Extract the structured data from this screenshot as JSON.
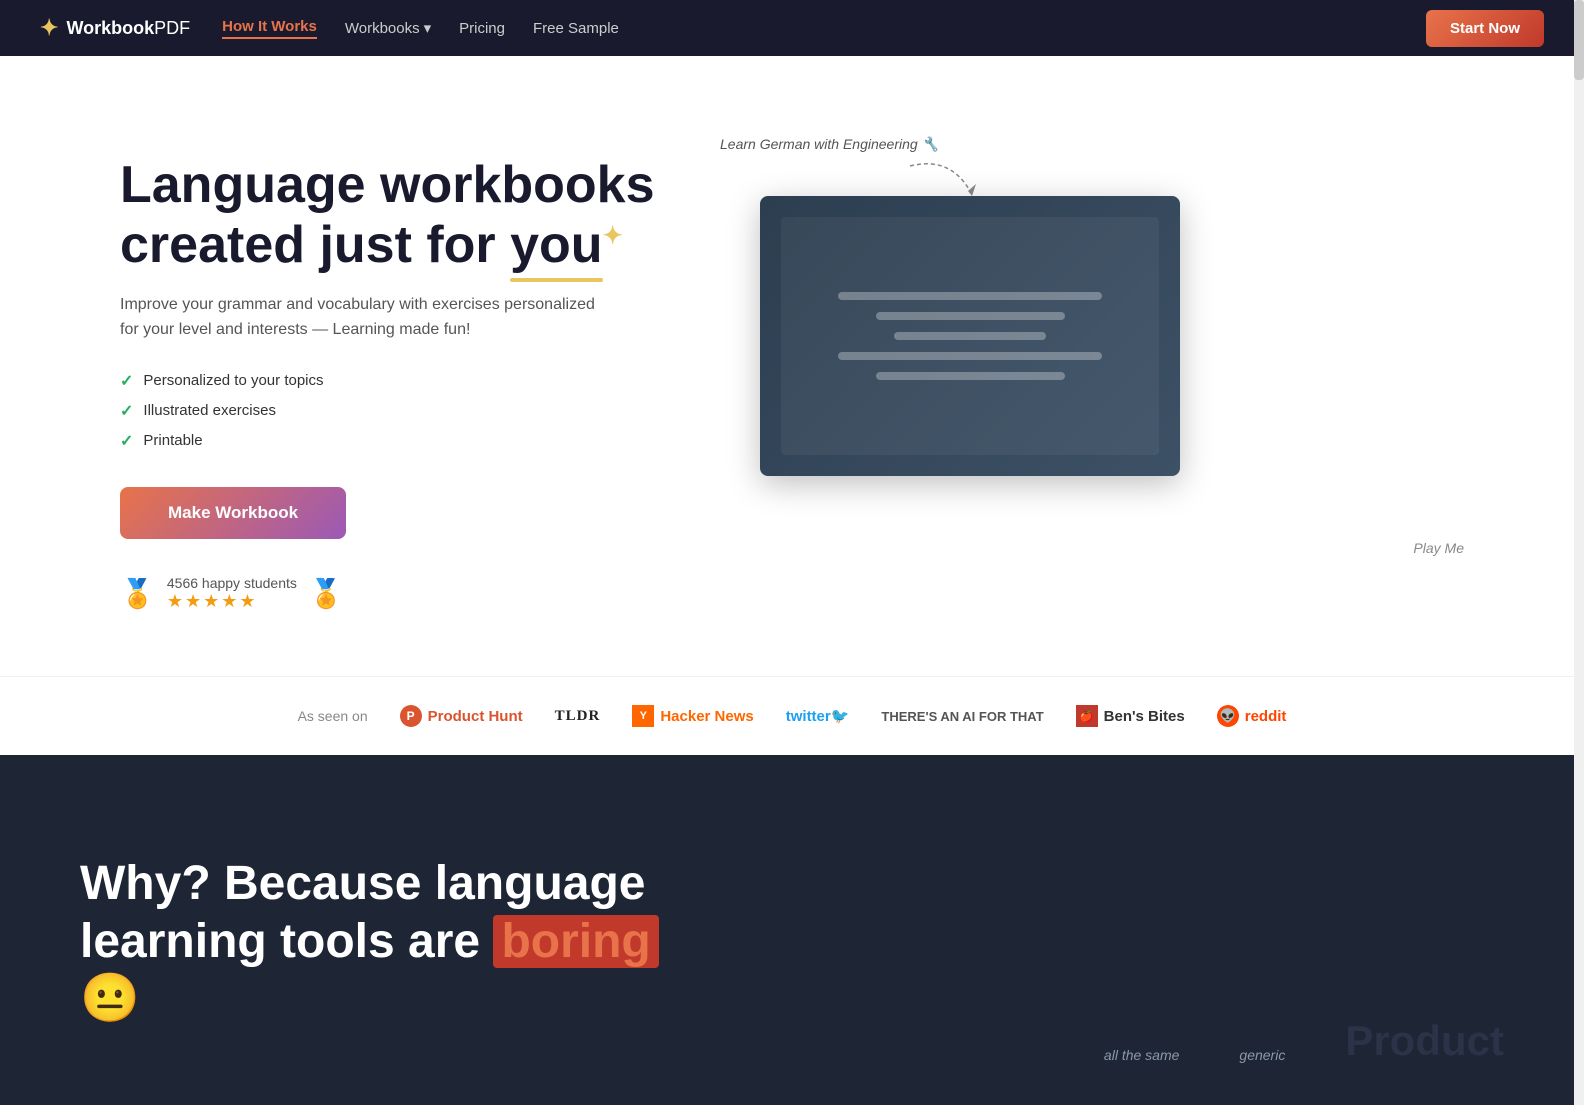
{
  "nav": {
    "logo_icon": "✦",
    "logo_workbook": "Workbook",
    "logo_pdf": "PDF",
    "links": [
      {
        "label": "How It Works",
        "active": true
      },
      {
        "label": "Workbooks",
        "dropdown": true
      },
      {
        "label": "Pricing",
        "active": false
      },
      {
        "label": "Free Sample",
        "active": false
      }
    ],
    "cta_label": "Start Now"
  },
  "hero": {
    "title_line1": "Language workbooks",
    "title_line2": "created just for",
    "title_you": "you",
    "sparkle": "✦",
    "subtitle": "Improve your grammar and vocabulary with exercises personalized for your level and interests — Learning made fun!",
    "checklist": [
      "Personalized to your topics",
      "Illustrated exercises",
      "Printable"
    ],
    "cta_label": "Make Workbook",
    "happy_students": "4566 happy students",
    "stars": "★★★★★",
    "annotation_label": "Learn German with Engineering 🔧",
    "play_me": "Play Me"
  },
  "as_seen_on": {
    "label": "As seen on",
    "logos": [
      {
        "name": "Product Hunt",
        "type": "producthunt"
      },
      {
        "name": "TLDR",
        "type": "tldr"
      },
      {
        "name": "Hacker News",
        "type": "hackernews"
      },
      {
        "name": "twitter🐦",
        "type": "twitter"
      },
      {
        "name": "THERE'S AN AI FOR THAT",
        "type": "theresanai"
      },
      {
        "name": "Ben's Bites",
        "type": "bens-bites"
      },
      {
        "name": "reddit",
        "type": "reddit"
      }
    ]
  },
  "dark_section": {
    "title_start": "Why? Because language learning tools are",
    "title_boring": "boring",
    "emoji": "😐",
    "anno_all_same": "all the same",
    "anno_generic": "generic",
    "product_label": "Product"
  }
}
